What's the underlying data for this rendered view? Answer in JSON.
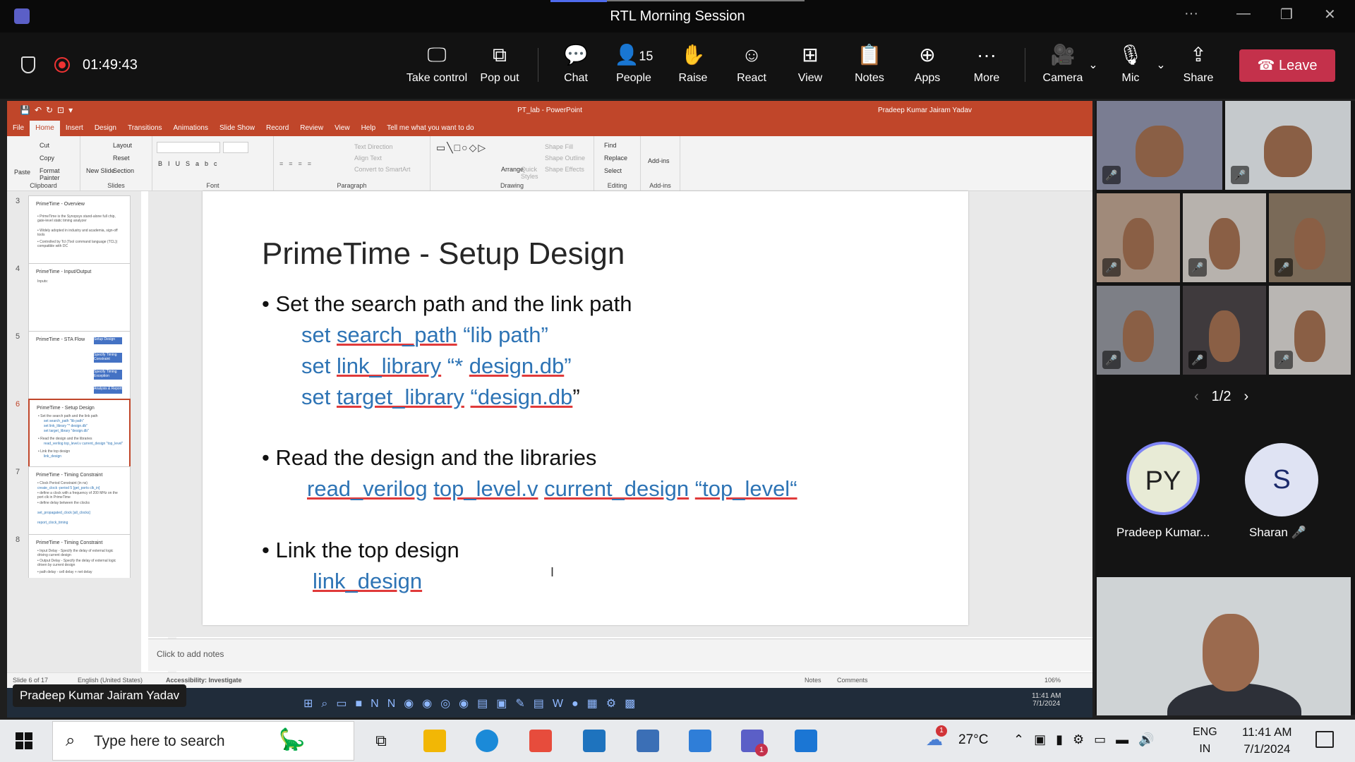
{
  "window": {
    "title": "RTL Morning Session"
  },
  "meeting": {
    "timer": "01:49:43",
    "buttons": {
      "take_control": "Take control",
      "pop_out": "Pop out",
      "chat": "Chat",
      "people": "People",
      "people_count": "15",
      "raise": "Raise",
      "react": "React",
      "view": "View",
      "notes": "Notes",
      "apps": "Apps",
      "more": "More",
      "camera": "Camera",
      "mic": "Mic",
      "share": "Share",
      "leave": "Leave"
    },
    "leave_color": "#c4314b"
  },
  "ppt": {
    "doc_title": "PT_lab - PowerPoint",
    "user": "Pradeep Kumar Jairam Yadav",
    "tabs": [
      "File",
      "Home",
      "Insert",
      "Design",
      "Transitions",
      "Animations",
      "Slide Show",
      "Record",
      "Review",
      "View",
      "Help",
      "Tell me what you want to do"
    ],
    "ribbon": {
      "clipboard": {
        "label": "Clipboard",
        "paste": "Paste",
        "cut": "Cut",
        "copy": "Copy",
        "format_painter": "Format Painter"
      },
      "slides": {
        "label": "Slides",
        "new_slide": "New Slide",
        "layout": "Layout",
        "reset": "Reset",
        "section": "Section"
      },
      "font": {
        "label": "Font"
      },
      "paragraph": {
        "label": "Paragraph",
        "text_direction": "Text Direction",
        "align_text": "Align Text",
        "convert": "Convert to SmartArt"
      },
      "drawing": {
        "label": "Drawing",
        "arrange": "Arrange",
        "quick_styles": "Quick Styles",
        "shape_fill": "Shape Fill",
        "shape_outline": "Shape Outline",
        "shape_effects": "Shape Effects"
      },
      "editing": {
        "label": "Editing",
        "find": "Find",
        "replace": "Replace",
        "select": "Select"
      },
      "addins": {
        "label": "Add-ins",
        "addins": "Add-ins"
      }
    },
    "thumbnails": [
      {
        "num": "3",
        "title": "PrimeTime - Overview",
        "lines": [
          "• PrimeTime is the Synopsys stand-alone full chip, gate-level static timing analyzer",
          "• Widely adopted in industry and academia, sign-off tools",
          "• Controlled by Tcl (Tool command language (TCL)) compatible with DC"
        ]
      },
      {
        "num": "4",
        "title": "PrimeTime - Input/Output",
        "lines": [
          "Inputs:"
        ]
      },
      {
        "num": "5",
        "title": "PrimeTime - STA Flow",
        "lines": [
          "Setup Design",
          "Specify Timing Constraint",
          "Specify Timing Exception",
          "Analysis & Report"
        ]
      },
      {
        "num": "6",
        "title": "PrimeTime - Setup Design",
        "lines": [
          "• Set the search path and the link path",
          "set search_path \"lib path\"",
          "set link_library \"* design.db\"",
          "set target_library \"design.db\"",
          "• Read the design and the libraries",
          "read_verilog top_level.v current_design \"top_level\"",
          "• Link the top design",
          "link_design"
        ]
      },
      {
        "num": "7",
        "title": "PrimeTime - Timing Constraint",
        "lines": [
          "• Clock Period Constraint (in ns)",
          "create_clock -period 5 [get_ports clk_in]",
          "• define a clock with a frequency of 200 MHz on the port clk in PrimeTime",
          "• define delay between the clocks",
          "set_propagated_clock [all_clocks]",
          "report_clock_timing"
        ]
      },
      {
        "num": "8",
        "title": "PrimeTime - Timing Constraint",
        "lines": [
          "• Input Delay - Specify the delay of external logic driving current design",
          "• Output Delay - Specify the delay of external logic driven by current design",
          "• path delay - cell delay + net delay"
        ]
      }
    ],
    "slide": {
      "title": "PrimeTime - Setup Design",
      "b1": "Set the search path and the link path",
      "c1_kw": "set",
      "c1_a": "search_path",
      "c1_b": "“lib path”",
      "c2_kw": "set",
      "c2_a": "link_library",
      "c2_b": "“*",
      "c2_c": "design.db",
      "c2_d": "”",
      "c3_kw": "set",
      "c3_a": "target_library",
      "c3_b": "“design.db",
      "c3_c": "”",
      "b2": "Read the design and the libraries",
      "c4_a": "read_verilog",
      "c4_b": "top_level.v",
      "c4_c": "current_design",
      "c4_d": "“top_level“",
      "b3": "Link the top design",
      "c5": "link_design"
    },
    "notes_placeholder": "Click to add notes",
    "status": {
      "slide": "Slide 6 of 17",
      "language": "English (United States)",
      "accessibility": "Accessibility: Investigate",
      "notes": "Notes",
      "comments": "Comments",
      "zoom": "106%"
    }
  },
  "presenter_name": "Pradeep Kumar Jairam Yadav",
  "inner_clock": {
    "time": "11:41 AM",
    "date": "7/1/2024"
  },
  "participants": {
    "pager": "1/2",
    "avatars": [
      {
        "initials": "PY",
        "name": "Pradeep Kumar...",
        "color": "#e8ebd6"
      },
      {
        "initials": "S",
        "name": "Sharan",
        "color": "#dfe3f3"
      }
    ]
  },
  "taskbar": {
    "search_placeholder": "Type here to search",
    "weather": "27°C",
    "weather_badge": "1",
    "teams_badge": "1",
    "lang1": "ENG",
    "lang2": "IN",
    "time": "11:41 AM",
    "date": "7/1/2024"
  }
}
